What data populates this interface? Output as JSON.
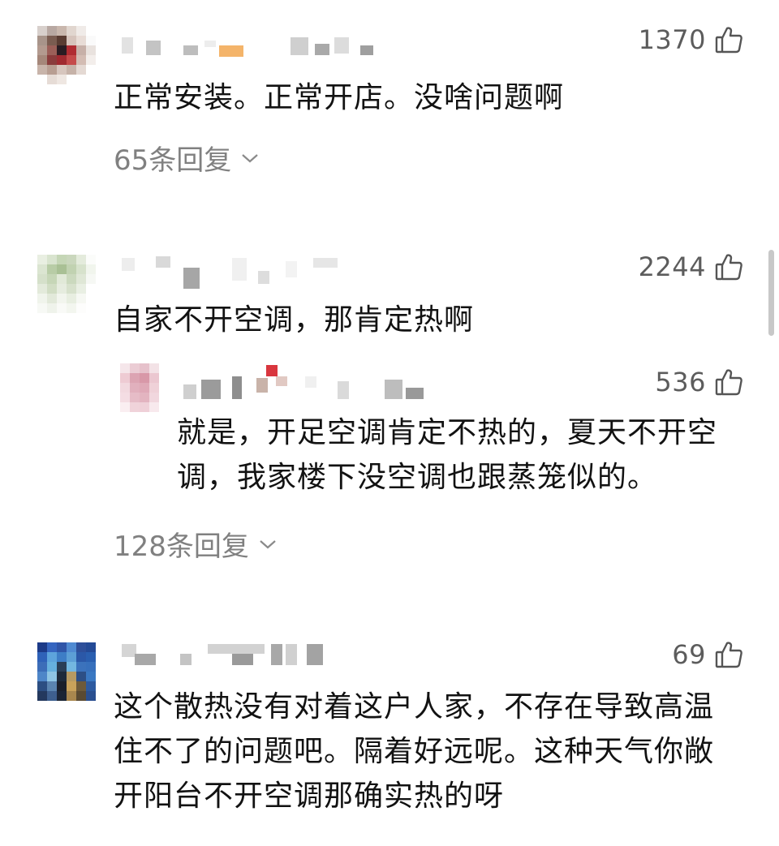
{
  "comments": [
    {
      "likes": "1370",
      "text": "正常安装。正常开店。没啥问题啊",
      "replies": "65条回复"
    },
    {
      "likes": "2244",
      "text": "自家不开空调，那肯定热啊",
      "reply": {
        "likes": "536",
        "text_line1": "就是，开足空调肯定不热的，夏天不开空",
        "text_line2": "调，我家楼下没空调也跟蒸笼似的。"
      },
      "replies": "128条回复"
    },
    {
      "likes": "69",
      "text_line1": "这个散热没有对着这户人家，不存在导致高温",
      "text_line2": "住不了的问题吧。隔着好远呢。这种天气你敞",
      "text_line3": "开阳台不开空调那确实热的呀"
    }
  ],
  "icons": {
    "like": "thumbs-up-icon",
    "expand": "chevron-down-icon"
  },
  "colors": {
    "text": "#121212",
    "meta": "#5c5c5c",
    "replies": "#808080"
  }
}
